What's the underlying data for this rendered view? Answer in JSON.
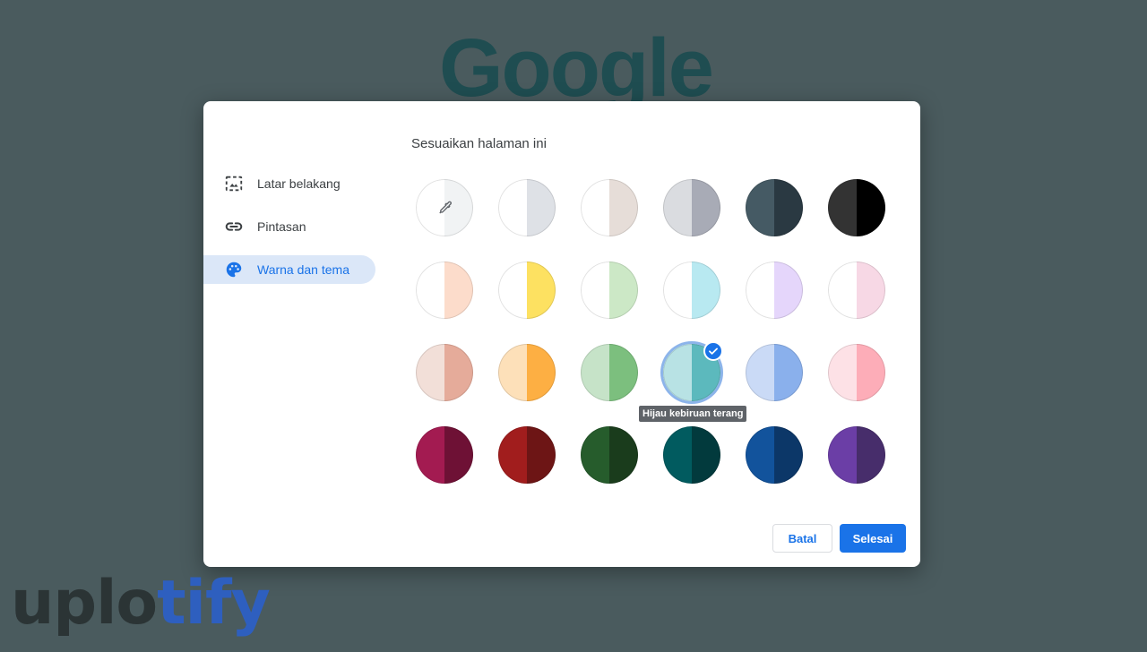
{
  "background": {
    "logo_text": "Google",
    "watermark": {
      "part1": "uplo",
      "part2": "tify"
    }
  },
  "dialog": {
    "heading": "Sesuaikan halaman ini",
    "sidebar": [
      {
        "label": "Latar belakang",
        "icon": "image-icon",
        "active": false
      },
      {
        "label": "Pintasan",
        "icon": "link-icon",
        "active": false
      },
      {
        "label": "Warna dan tema",
        "icon": "palette-icon",
        "active": true
      }
    ],
    "swatches": [
      {
        "left": "#ffffff",
        "right": "#f1f3f4",
        "picker": true
      },
      {
        "left": "#ffffff",
        "right": "#dee1e6"
      },
      {
        "left": "#ffffff",
        "right": "#e6ddd8"
      },
      {
        "left": "#dadce0",
        "right": "#a8abb6"
      },
      {
        "left": "#455a64",
        "right": "#2a3942"
      },
      {
        "left": "#333333",
        "right": "#000000"
      },
      {
        "left": "#ffffff",
        "right": "#fcdccb"
      },
      {
        "left": "#ffffff",
        "right": "#fde161"
      },
      {
        "left": "#ffffff",
        "right": "#cce8c6"
      },
      {
        "left": "#ffffff",
        "right": "#b8e9f1"
      },
      {
        "left": "#ffffff",
        "right": "#e5d6fb"
      },
      {
        "left": "#ffffff",
        "right": "#f7d8e5"
      },
      {
        "left": "#f2dfd8",
        "right": "#e5ab9a"
      },
      {
        "left": "#fde0b9",
        "right": "#fdaf43"
      },
      {
        "left": "#c6e3c8",
        "right": "#7cbf7e"
      },
      {
        "left": "#b8e2e4",
        "right": "#5cb9bd",
        "selected": true,
        "tooltip": "Hijau kebiruan terang"
      },
      {
        "left": "#cadaf6",
        "right": "#8ab0ec"
      },
      {
        "left": "#fde1e6",
        "right": "#fdadb8"
      },
      {
        "left": "#a31b51",
        "right": "#6e1135"
      },
      {
        "left": "#a11d1d",
        "right": "#6d1515"
      },
      {
        "left": "#265c2c",
        "right": "#1a3c1c"
      },
      {
        "left": "#015b5f",
        "right": "#023a3d"
      },
      {
        "left": "#12539c",
        "right": "#0c3768"
      },
      {
        "left": "#6b3ea6",
        "right": "#472d6b"
      }
    ],
    "buttons": {
      "cancel": "Batal",
      "done": "Selesai"
    },
    "colors": {
      "accent": "#1a73e8",
      "active_bg": "#dbe7f8"
    }
  }
}
